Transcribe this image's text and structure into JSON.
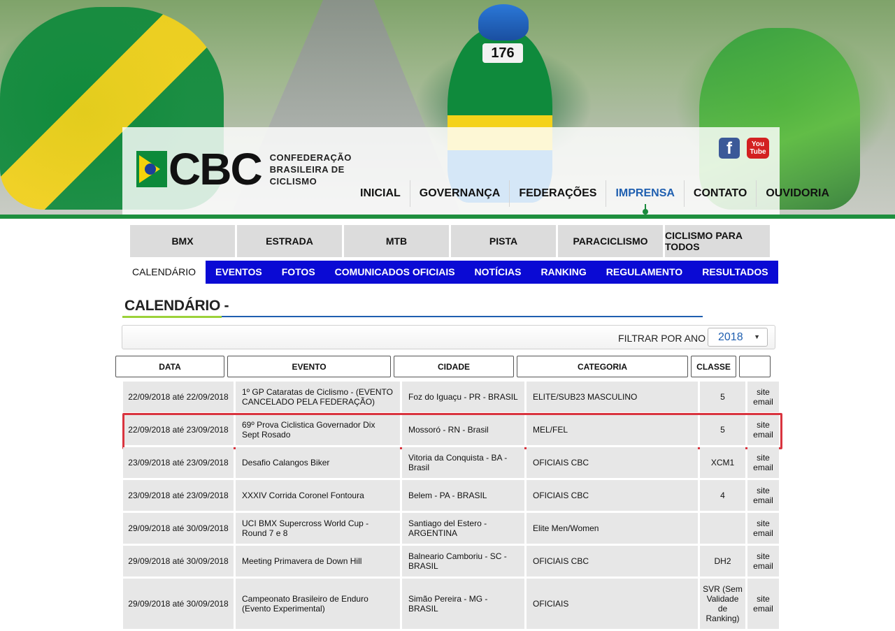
{
  "brand": {
    "logo_text": "CBC",
    "org_line1": "CONFEDERAÇÃO",
    "org_line2": "BRASILEIRA DE",
    "org_line3": "CICLISMO",
    "hero_bib": "176",
    "colors": {
      "green": "#1e8f3e",
      "nav_blue": "#0a0ad4",
      "active_blue": "#1f5fb0",
      "highlight_red": "#d9343f"
    }
  },
  "social": {
    "facebook": "f",
    "youtube_line1": "You",
    "youtube_line2": "Tube"
  },
  "main_nav": [
    {
      "label": "INICIAL"
    },
    {
      "label": "GOVERNANÇA"
    },
    {
      "label": "FEDERAÇÕES"
    },
    {
      "label": "IMPRENSA",
      "active": true
    },
    {
      "label": "CONTATO"
    },
    {
      "label": "OUVIDORIA"
    }
  ],
  "category_tabs": [
    {
      "label": "BMX"
    },
    {
      "label": "ESTRADA"
    },
    {
      "label": "MTB"
    },
    {
      "label": "PISTA"
    },
    {
      "label": "PARACICLISMO"
    },
    {
      "label": "CICLISMO PARA TODOS"
    }
  ],
  "sub_nav": [
    {
      "label": "CALENDÁRIO",
      "active": true
    },
    {
      "label": "EVENTOS"
    },
    {
      "label": "FOTOS"
    },
    {
      "label": "COMUNICADOS OFICIAIS"
    },
    {
      "label": "NOTÍCIAS"
    },
    {
      "label": "RANKING"
    },
    {
      "label": "REGULAMENTO"
    },
    {
      "label": "RESULTADOS"
    }
  ],
  "page": {
    "title": "CALENDÁRIO -"
  },
  "filter": {
    "label": "FILTRAR POR ANO",
    "selected_year": "2018"
  },
  "table": {
    "headers": {
      "date": "DATA",
      "event": "EVENTO",
      "city": "CIDADE",
      "category": "CATEGORIA",
      "class": "CLASSE",
      "links": ""
    },
    "rows": [
      {
        "date": "22/09/2018 até 22/09/2018",
        "event": "1º GP Cataratas de Ciclismo - (EVENTO CANCELADO PELA FEDERAÇÃO)",
        "city": "Foz do Iguaçu - PR - BRASIL",
        "category": "ELITE/SUB23 MASCULINO",
        "class": "5",
        "site": "site",
        "email": "email"
      },
      {
        "date": "22/09/2018 até 23/09/2018",
        "event": "69º Prova Ciclistica Governador Dix Sept Rosado",
        "city": "Mossoró - RN - Brasil",
        "category": "MEL/FEL",
        "class": "5",
        "site": "site",
        "email": "email",
        "highlight": true
      },
      {
        "date": "23/09/2018 até 23/09/2018",
        "event": "Desafio Calangos Biker",
        "city": "Vitoria da Conquista - BA - Brasil",
        "category": "OFICIAIS CBC",
        "class": "XCM1",
        "site": "site",
        "email": "email"
      },
      {
        "date": "23/09/2018 até 23/09/2018",
        "event": "XXXIV Corrida Coronel Fontoura",
        "city": "Belem - PA - BRASIL",
        "category": "OFICIAIS CBC",
        "class": "4",
        "site": "site",
        "email": "email"
      },
      {
        "date": "29/09/2018 até 30/09/2018",
        "event": "UCI BMX Supercross World Cup - Round 7 e 8",
        "city": "Santiago del Estero - ARGENTINA",
        "category": "Elite Men/Women",
        "class": "",
        "site": "site",
        "email": "email"
      },
      {
        "date": "29/09/2018 até 30/09/2018",
        "event": "Meeting Primavera de Down Hill",
        "city": "Balneario Camboriu - SC - BRASIL",
        "category": "OFICIAIS CBC",
        "class": "DH2",
        "site": "site",
        "email": "email"
      },
      {
        "date": "29/09/2018 até 30/09/2018",
        "event": "Campeonato Brasileiro de Enduro (Evento Experimental)",
        "city": "Simão Pereira - MG - BRASIL",
        "category": "OFICIAIS",
        "class": "SVR (Sem Validade de Ranking)",
        "site": "site",
        "email": "email"
      }
    ]
  }
}
